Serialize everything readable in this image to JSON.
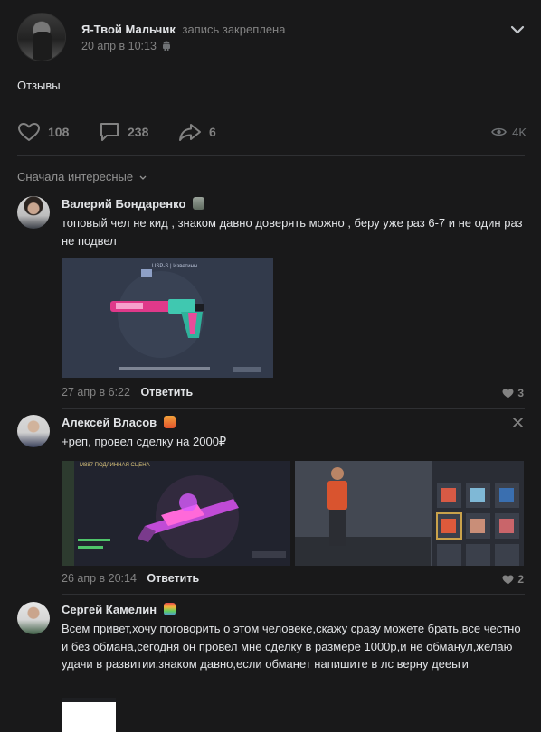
{
  "post": {
    "author": "Я-Твой Мальчик",
    "pinned_note": "запись закреплена",
    "date": "20 апр в 10:13",
    "text": "Отзывы",
    "likes": "108",
    "comments": "238",
    "shares": "6",
    "views": "4K"
  },
  "comments_section": {
    "sort_label": "Сначала интересные"
  },
  "comments": [
    {
      "author": "Валерий Бондаренко",
      "text": "топовый чел не кид , знаком давно доверять можно , беру уже раз 6-7 и не один раз не подвел",
      "date": "27 апр в 6:22",
      "reply_label": "Ответить",
      "likes": "3",
      "image_caption": "USP-S | Изветины"
    },
    {
      "author": "Алексей Власов",
      "text": "+реп, провел сделку на 2000₽",
      "date": "26 апр в 20:14",
      "reply_label": "Ответить",
      "likes": "2",
      "image_caption": "M887 ПОДЛИННАЯ СЦЕНА"
    },
    {
      "author": "Сергей Камелин",
      "text": "Всем привет,хочу поговорить о этом человеке,скажу сразу можете брать,все честно и без обмана,сегодня он провел мне сделку в размере 1000р,и не обманул,желаю удачи в развитии,знаком давно,если обманет напишите в лс верну дееьги"
    }
  ],
  "colors": {
    "background": "#19191a",
    "text": "#e1e3e6",
    "secondary": "#828282",
    "divider": "#2f3033"
  },
  "icons": [
    "android-icon",
    "chevron-down-icon",
    "heart-icon",
    "comment-icon",
    "share-icon",
    "eye-icon",
    "close-icon"
  ]
}
